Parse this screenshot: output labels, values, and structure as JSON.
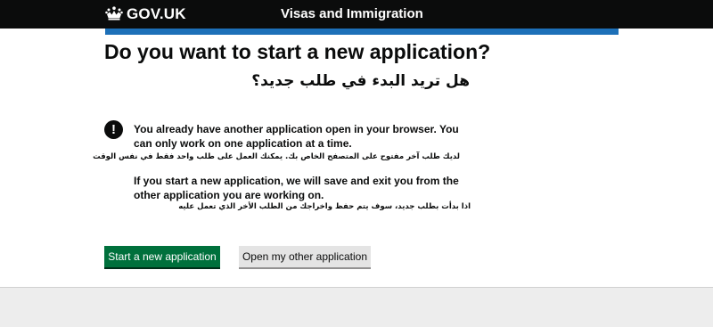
{
  "header": {
    "logo_text": "GOV.UK",
    "service_name": "Visas and Immigration"
  },
  "main": {
    "title": "Do you want to start a new application?",
    "title_ar": "هل تريد البدء في طلب جديد؟",
    "warning": {
      "icon": "!",
      "text": "You already have another application open in your browser. You can only work on one application at a time.",
      "text_ar": "لديك طلب آخر مفتوح على المتصفح الخاص بك. يمكنك العمل على طلب واحد فقط في نفس الوقت"
    },
    "info": {
      "text": "If you start a new application, we will save and exit you from the other application you are working on.",
      "text_ar": "اذا بدأت بطلب جديد، سوف يتم حفظ واخراجك من الطلب الأخر الذي تعمل عليه"
    },
    "buttons": {
      "start_label": "Start a new application",
      "open_other_label": "Open my other application"
    }
  },
  "colors": {
    "header_bg": "#0b0c0c",
    "accent_bar": "#1d70b8",
    "primary_button": "#00703c",
    "secondary_button": "#e4e4e4",
    "footer_bg": "#ededed"
  },
  "icons": {
    "logo": "crown-icon",
    "warning": "exclamation-icon"
  }
}
